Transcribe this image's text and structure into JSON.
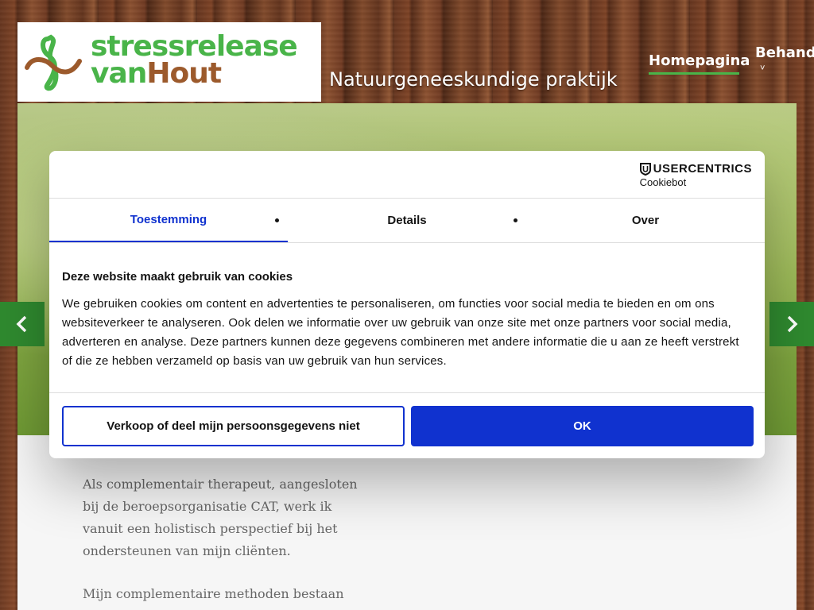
{
  "site": {
    "logo_line1": "stressrelease",
    "logo_line2_part1": "van",
    "logo_line2_part2": "Hout",
    "tagline": "Natuurgeneeskundige praktijk"
  },
  "nav": {
    "home": "Homepagina",
    "behandel": "Behande",
    "chevron": "˅"
  },
  "slider": {
    "prev": "‹",
    "next": "›"
  },
  "content": {
    "p1": "Als complementair therapeut, aangesloten bij de beroepsorganisatie CAT, werk ik vanuit een holistisch perspectief bij het ondersteunen van mijn cliënten.",
    "p2": "Mijn complementaire methoden bestaan"
  },
  "cookie": {
    "brand": "USERCENTRICS",
    "brand_sub": "Cookiebot",
    "tabs": [
      "Toestemming",
      "Details",
      "Over"
    ],
    "title": "Deze website maakt gebruik van cookies",
    "text": "We gebruiken cookies om content en advertenties te personaliseren, om functies voor social media te bieden en om ons websiteverkeer te analyseren. Ook delen we informatie over uw gebruik van onze site met onze partners voor social media, adverteren en analyse. Deze partners kunnen deze gegevens combineren met andere informatie die u aan ze heeft verstrekt of die ze hebben verzameld op basis van uw gebruik van hun services.",
    "btn_deny": "Verkoop of deel mijn persoonsgegevens niet",
    "btn_ok": "OK"
  },
  "colors": {
    "accent": "#1032cf",
    "green": "#49b449",
    "brown": "#9c5a2c"
  }
}
